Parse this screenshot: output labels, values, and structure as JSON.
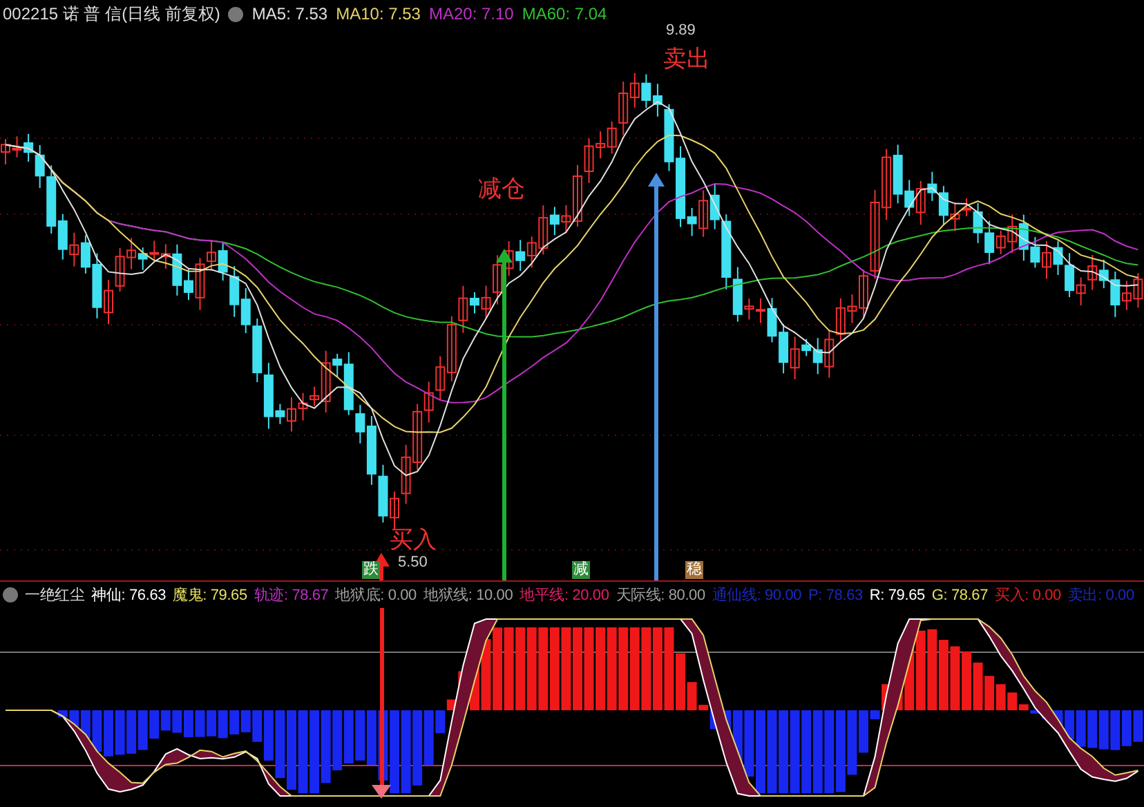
{
  "header": {
    "symbol": "002215",
    "name": "诺 普 信",
    "period": "(日线 前复权)",
    "ma": [
      {
        "text": "MA5: 7.53",
        "color": "#e0e0e0"
      },
      {
        "text": "MA10: 7.53",
        "color": "#e6d36a"
      },
      {
        "text": "MA20: 7.10",
        "color": "#c030c8"
      },
      {
        "text": "MA60: 7.04",
        "color": "#30c030"
      }
    ]
  },
  "chart": {
    "high_label": "9.89",
    "low_label": "5.50",
    "signals": [
      {
        "kind": "buy",
        "text": "买入"
      },
      {
        "kind": "reduce",
        "text": "减仓"
      },
      {
        "kind": "sell",
        "text": "卖出"
      }
    ],
    "badges": [
      {
        "text": "跌",
        "color": "#2e8b3a"
      },
      {
        "text": "减",
        "color": "#2e8b3a"
      },
      {
        "text": "稳",
        "color": "#a0703a"
      }
    ]
  },
  "indicator": {
    "title": "一绝红尘",
    "values": [
      {
        "text": "神仙: 76.63",
        "color": "#ffffff"
      },
      {
        "text": "魔鬼: 79.65",
        "color": "#e6e060"
      },
      {
        "text": "轨迹: 78.67",
        "color": "#c030c8"
      },
      {
        "text": "地狱底: 0.00",
        "color": "#a0a0a0"
      },
      {
        "text": "地狱线: 10.00",
        "color": "#a0a0a0"
      },
      {
        "text": "地平线: 20.00",
        "color": "#e0206a"
      },
      {
        "text": "天际线: 80.00",
        "color": "#a0a0a0"
      },
      {
        "text": "通仙线: 90.00",
        "color": "#1a28c0"
      },
      {
        "text": "P: 78.63",
        "color": "#1a28c0"
      },
      {
        "text": "R: 79.65",
        "color": "#ffffff"
      },
      {
        "text": "G: 78.67",
        "color": "#e6e060"
      },
      {
        "text": "买入: 0.00",
        "color": "#e02020"
      },
      {
        "text": "卖出: 0.00",
        "color": "#1a28c0"
      }
    ]
  }
}
